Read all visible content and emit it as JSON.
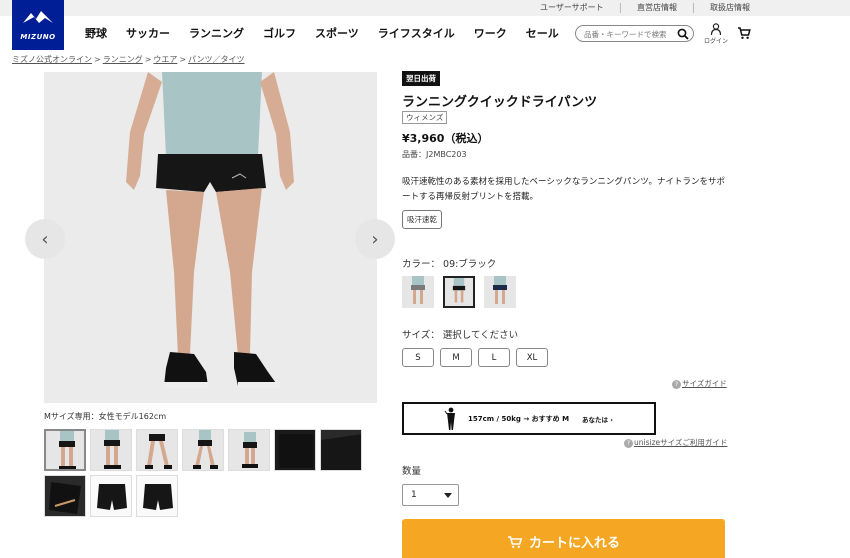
{
  "utility_links": [
    "ユーザーサポート",
    "直営店情報",
    "取扱店情報"
  ],
  "brand": {
    "wordmark": "MIZUNO",
    "color": "#001e96"
  },
  "nav": [
    "野球",
    "サッカー",
    "ランニング",
    "ゴルフ",
    "スポーツ",
    "ライフスタイル",
    "ワーク",
    "セール"
  ],
  "search": {
    "placeholder": "品番・キーワードで検索",
    "icon": "search-icon"
  },
  "login_label": "ログイン",
  "breadcrumb": [
    "ミズノ公式オンライン",
    "ランニング",
    "ウエア",
    "パンツ／タイツ"
  ],
  "gallery": {
    "caption": "Mサイズ専用：女性モデル162cm",
    "prev_icon": "chevron-left-icon",
    "next_icon": "chevron-right-icon",
    "thumb_count": 10
  },
  "product": {
    "badge": "翌日出荷",
    "title": "ランニングクイックドライパンツ",
    "gender": "ウィメンズ",
    "price": "¥3,960（税込）",
    "sku": "品番：J2MBC203",
    "description": "吸汗速乾性のある素材を採用したベーシックなランニングパンツ。ナイトランをサポートする再帰反射プリントを搭載。",
    "feature_tag": "吸汗速乾",
    "color_label": "カラー： 09:ブラック",
    "size_label": "サイズ： 選択してください",
    "sizes": [
      "S",
      "M",
      "L",
      "XL"
    ],
    "size_guide": "サイズガイド",
    "unisize": {
      "text": "157cm / 50kg → おすすめ M",
      "you": "あなたは"
    },
    "unisize_guide": "unisizeサイズご利用ガイド",
    "qty_label": "数量",
    "qty_value": "1",
    "add_to_cart": "カートに入れる",
    "accent": "#f5a623"
  }
}
